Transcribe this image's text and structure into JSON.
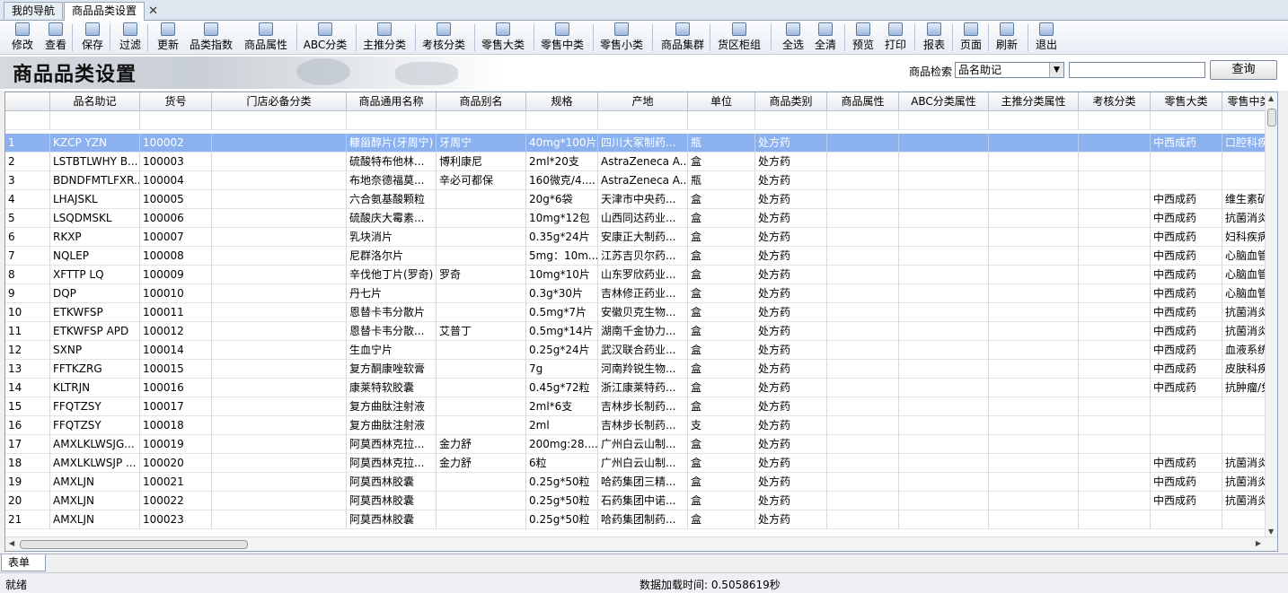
{
  "tabs": [
    {
      "label": "我的导航",
      "active": false
    },
    {
      "label": "商品品类设置",
      "active": true
    }
  ],
  "toolbar": [
    {
      "name": "edit",
      "label": "修改",
      "icon": "edit-icon"
    },
    {
      "name": "view",
      "label": "查看",
      "icon": "view-icon"
    },
    {
      "name": "save",
      "label": "保存",
      "icon": "save-icon"
    },
    {
      "name": "filter",
      "label": "过滤",
      "icon": "binoculars-icon"
    },
    {
      "name": "update",
      "label": "更新",
      "icon": "update-icon"
    },
    {
      "name": "category-index",
      "label": "品类指数",
      "icon": "index-icon"
    },
    {
      "name": "product-attr",
      "label": "商品属性",
      "icon": "attr-icon"
    },
    {
      "name": "abc-class",
      "label": "ABC分类",
      "icon": "abc-icon"
    },
    {
      "name": "main-push",
      "label": "主推分类",
      "icon": "push-icon"
    },
    {
      "name": "assess",
      "label": "考核分类",
      "icon": "assess-icon"
    },
    {
      "name": "retail-major",
      "label": "零售大类",
      "icon": "major-icon"
    },
    {
      "name": "retail-mid",
      "label": "零售中类",
      "icon": "mid-icon"
    },
    {
      "name": "retail-minor",
      "label": "零售小类",
      "icon": "minor-icon"
    },
    {
      "name": "product-group",
      "label": "商品集群",
      "icon": "group-icon"
    },
    {
      "name": "shelf",
      "label": "货区柜组",
      "icon": "shelf-icon"
    },
    {
      "name": "select-all",
      "label": "全选",
      "icon": "select-all-icon"
    },
    {
      "name": "clear-all",
      "label": "全清",
      "icon": "clear-all-icon"
    },
    {
      "name": "preview",
      "label": "预览",
      "icon": "preview-icon"
    },
    {
      "name": "print",
      "label": "打印",
      "icon": "printer-icon"
    },
    {
      "name": "report",
      "label": "报表",
      "icon": "report-icon"
    },
    {
      "name": "page",
      "label": "页面",
      "icon": "page-icon"
    },
    {
      "name": "refresh",
      "label": "刷新",
      "icon": "refresh-icon"
    },
    {
      "name": "exit",
      "label": "退出",
      "icon": "exit-icon"
    }
  ],
  "banner": {
    "title": "商品品类设置"
  },
  "search": {
    "label": "商品检索",
    "field": "品名助记",
    "query_label": "查询"
  },
  "table": {
    "columns": [
      "",
      "品名助记",
      "货号",
      "门店必备分类",
      "商品通用名称",
      "商品别名",
      "规格",
      "产地",
      "单位",
      "商品类别",
      "商品属性",
      "ABC分类属性",
      "主推分类属性",
      "考核分类",
      "零售大类",
      "零售中类"
    ],
    "rows": [
      [
        "1",
        "KZCP YZN",
        "100002",
        "",
        "糠甾醇片(牙周宁)",
        "牙周宁",
        "40mg*100片",
        "四川大冢制药...",
        "瓶",
        "处方药",
        "",
        "",
        "",
        "",
        "中西成药",
        "口腔科疾"
      ],
      [
        "2",
        "LSTBTLWHY B...",
        "100003",
        "",
        "硫酸特布他林...",
        "博利康尼",
        "2ml*20支",
        "AstraZeneca A...",
        "盒",
        "处方药",
        "",
        "",
        "",
        "",
        "",
        ""
      ],
      [
        "3",
        "BDNDFMTLFXR...",
        "100004",
        "",
        "布地奈德福莫...",
        "辛必可都保",
        "160微克/4....",
        "AstraZeneca A...",
        "瓶",
        "处方药",
        "",
        "",
        "",
        "",
        "",
        ""
      ],
      [
        "4",
        "LHAJSKL",
        "100005",
        "",
        "六合氨基酸颗粒",
        "",
        "20g*6袋",
        "天津市中央药...",
        "盒",
        "处方药",
        "",
        "",
        "",
        "",
        "中西成药",
        "维生素矿"
      ],
      [
        "5",
        "LSQDMSKL",
        "100006",
        "",
        "硫酸庆大霉素...",
        "",
        "10mg*12包",
        "山西同达药业...",
        "盒",
        "处方药",
        "",
        "",
        "",
        "",
        "中西成药",
        "抗菌消炎"
      ],
      [
        "6",
        "RKXP",
        "100007",
        "",
        "乳块消片",
        "",
        "0.35g*24片",
        "安康正大制药...",
        "盒",
        "处方药",
        "",
        "",
        "",
        "",
        "中西成药",
        "妇科疾病"
      ],
      [
        "7",
        "NQLEP",
        "100008",
        "",
        "尼群洛尔片",
        "",
        "5mg：10m...",
        "江苏吉贝尔药...",
        "盒",
        "处方药",
        "",
        "",
        "",
        "",
        "中西成药",
        "心脑血管"
      ],
      [
        "8",
        "XFTTP LQ",
        "100009",
        "",
        "辛伐他丁片(罗奇)",
        "罗奇",
        "10mg*10片",
        "山东罗欣药业...",
        "盒",
        "处方药",
        "",
        "",
        "",
        "",
        "中西成药",
        "心脑血管"
      ],
      [
        "9",
        "DQP",
        "100010",
        "",
        "丹七片",
        "",
        "0.3g*30片",
        "吉林修正药业...",
        "盒",
        "处方药",
        "",
        "",
        "",
        "",
        "中西成药",
        "心脑血管"
      ],
      [
        "10",
        "ETKWFSP",
        "100011",
        "",
        "恩替卡韦分散片",
        "",
        "0.5mg*7片",
        "安徽贝克生物...",
        "盒",
        "处方药",
        "",
        "",
        "",
        "",
        "中西成药",
        "抗菌消炎"
      ],
      [
        "11",
        "ETKWFSP APD",
        "100012",
        "",
        "恩替卡韦分散...",
        "艾普丁",
        "0.5mg*14片",
        "湖南千金协力...",
        "盒",
        "处方药",
        "",
        "",
        "",
        "",
        "中西成药",
        "抗菌消炎"
      ],
      [
        "12",
        "SXNP",
        "100014",
        "",
        "生血宁片",
        "",
        "0.25g*24片",
        "武汉联合药业...",
        "盒",
        "处方药",
        "",
        "",
        "",
        "",
        "中西成药",
        "血液系统"
      ],
      [
        "13",
        "FFTKZRG",
        "100015",
        "",
        "复方酮康唑软膏",
        "",
        "7g",
        "河南羚锐生物...",
        "盒",
        "处方药",
        "",
        "",
        "",
        "",
        "中西成药",
        "皮肤科疾"
      ],
      [
        "14",
        "KLTRJN",
        "100016",
        "",
        "康莱特软胶囊",
        "",
        "0.45g*72粒",
        "浙江康莱特药...",
        "盒",
        "处方药",
        "",
        "",
        "",
        "",
        "中西成药",
        "抗肿瘤/免"
      ],
      [
        "15",
        "FFQTZSY",
        "100017",
        "",
        "复方曲肽注射液",
        "",
        "2ml*6支",
        "吉林步长制药...",
        "盒",
        "处方药",
        "",
        "",
        "",
        "",
        "",
        ""
      ],
      [
        "16",
        "FFQTZSY",
        "100018",
        "",
        "复方曲肽注射液",
        "",
        "2ml",
        "吉林步长制药...",
        "支",
        "处方药",
        "",
        "",
        "",
        "",
        "",
        ""
      ],
      [
        "17",
        "AMXLKLWSJG...",
        "100019",
        "",
        "阿莫西林克拉...",
        "金力舒",
        "200mg:28....",
        "广州白云山制...",
        "盒",
        "处方药",
        "",
        "",
        "",
        "",
        "",
        ""
      ],
      [
        "18",
        "AMXLKLWSJP ...",
        "100020",
        "",
        "阿莫西林克拉...",
        "金力舒",
        "6粒",
        "广州白云山制...",
        "盒",
        "处方药",
        "",
        "",
        "",
        "",
        "中西成药",
        "抗菌消炎"
      ],
      [
        "19",
        "AMXLJN",
        "100021",
        "",
        "阿莫西林胶囊",
        "",
        "0.25g*50粒",
        "哈药集团三精...",
        "盒",
        "处方药",
        "",
        "",
        "",
        "",
        "中西成药",
        "抗菌消炎"
      ],
      [
        "20",
        "AMXLJN",
        "100022",
        "",
        "阿莫西林胶囊",
        "",
        "0.25g*50粒",
        "石药集团中诺...",
        "盒",
        "处方药",
        "",
        "",
        "",
        "",
        "中西成药",
        "抗菌消炎"
      ],
      [
        "21",
        "AMXLJN",
        "100023",
        "",
        "阿莫西林胶囊",
        "",
        "0.25g*50粒",
        "哈药集团制药...",
        "盒",
        "处方药",
        "",
        "",
        "",
        "",
        "",
        ""
      ]
    ]
  },
  "bottom_tab": "表单",
  "status": {
    "left": "就绪",
    "load_time": "数据加载时间: 0.5058619秒"
  },
  "colors": {
    "selected_row": "#8bb1ef",
    "tab_active": "#ffffff"
  }
}
